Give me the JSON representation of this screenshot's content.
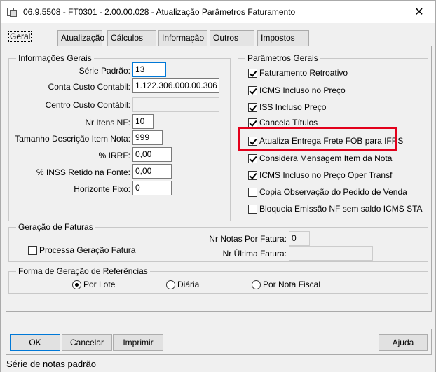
{
  "window": {
    "title": "06.9.5508 - FT0301 - 2.00.00.028 - Atualização Parâmetros Faturamento",
    "close_glyph": "✕"
  },
  "tabs": [
    {
      "label": "Geral",
      "active": true
    },
    {
      "label": "Atualização",
      "active": false
    },
    {
      "label": "Cálculos",
      "active": false
    },
    {
      "label": "Informação",
      "active": false
    },
    {
      "label": "Outros",
      "active": false
    },
    {
      "label": "Impostos",
      "active": false
    }
  ],
  "informacoes_gerais": {
    "title": "Informações Gerais",
    "fields": [
      {
        "label": "Série Padrão:",
        "value": "13"
      },
      {
        "label": "Conta Custo Contabil:",
        "value": "1.122.306.000.00.306"
      },
      {
        "label": "Centro Custo Contábil:",
        "value": ""
      },
      {
        "label": "Nr Itens NF:",
        "value": "10"
      },
      {
        "label": "Tamanho Descrição Item Nota:",
        "value": "999"
      },
      {
        "label": "% IRRF:",
        "value": "0,00"
      },
      {
        "label": "% INSS Retido na Fonte:",
        "value": "0,00"
      },
      {
        "label": "Horizonte Fixo:",
        "value": "0"
      }
    ]
  },
  "parametros_gerais": {
    "title": "Parâmetros Gerais",
    "options": [
      {
        "label": "Faturamento Retroativo",
        "checked": true
      },
      {
        "label": "ICMS Incluso no Preço",
        "checked": true
      },
      {
        "label": "ISS Incluso Preço",
        "checked": true
      },
      {
        "label": "Cancela Títulos",
        "checked": true
      },
      {
        "label": "Atualiza Entrega Frete FOB para IFRS",
        "checked": true
      },
      {
        "label": "Considera Mensagem Item da Nota",
        "checked": true
      },
      {
        "label": "ICMS Incluso no Preço Oper Transf",
        "checked": true
      },
      {
        "label": "Copia Observação do Pedido de Venda",
        "checked": false
      },
      {
        "label": "Bloqueia Emissão NF sem saldo ICMS STA",
        "checked": false
      }
    ]
  },
  "geracao_faturas": {
    "title": "Geração de Faturas",
    "processa_label": "Processa Geração Fatura",
    "processa_checked": false,
    "nr_notas_label": "Nr Notas Por Fatura:",
    "nr_notas_value": "0",
    "nr_ultima_label": "Nr Última Fatura:",
    "nr_ultima_value": ""
  },
  "forma_geracao": {
    "title": "Forma de Geração de Referências",
    "options": [
      {
        "label": "Por Lote",
        "selected": true
      },
      {
        "label": "Diária",
        "selected": false
      },
      {
        "label": "Por Nota Fiscal",
        "selected": false
      }
    ]
  },
  "buttons": {
    "ok": "OK",
    "cancelar": "Cancelar",
    "imprimir": "Imprimir",
    "ajuda": "Ajuda"
  },
  "status_bar": {
    "text": "Série de notas padrão"
  },
  "colors": {
    "highlight": "#e3001b",
    "focus": "#0078d7"
  }
}
